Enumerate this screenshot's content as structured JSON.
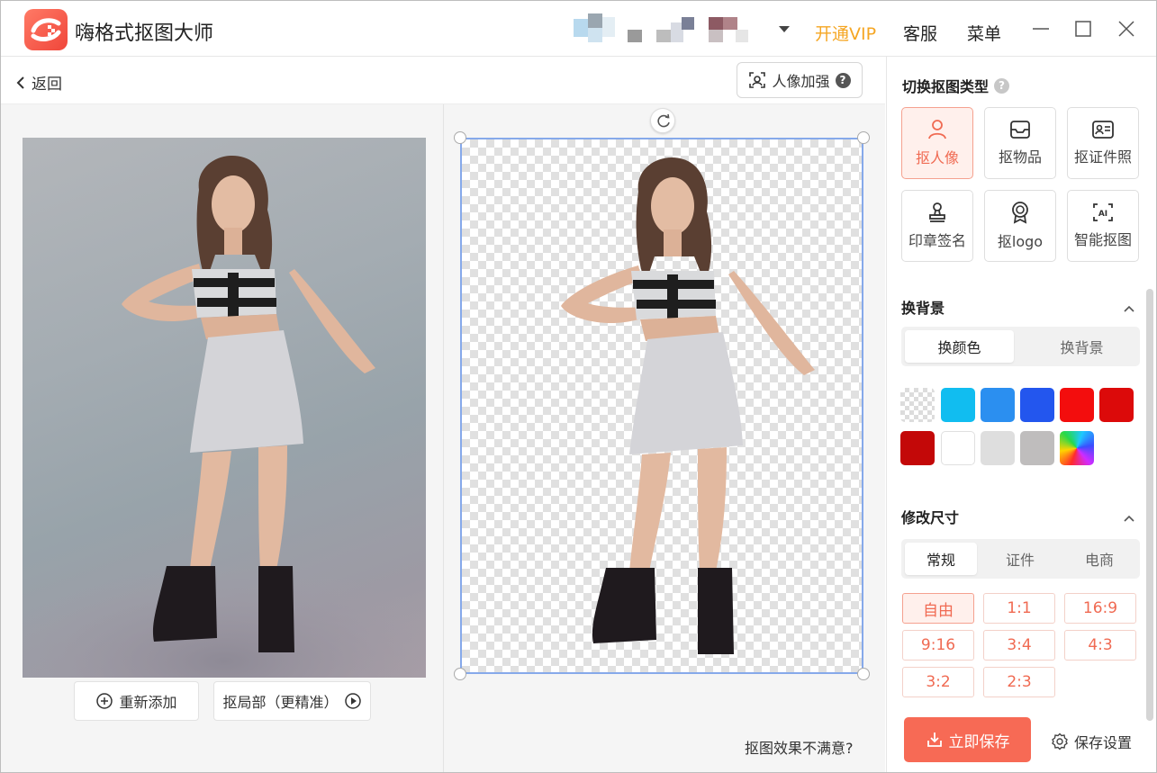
{
  "titlebar": {
    "app_title": "嗨格式抠图大师",
    "vip_label": "开通VIP",
    "service_label": "客服",
    "menu_label": "菜单"
  },
  "toolbar": {
    "back_label": "返回",
    "enhance_label": "人像加强"
  },
  "canvas": {
    "re_add_label": "重新添加",
    "partial_label": "抠局部（更精准）",
    "unsatisfied_label": "抠图效果不满意?"
  },
  "cutout_type": {
    "title": "切换抠图类型",
    "items": [
      {
        "label": "抠人像",
        "icon": "person-icon",
        "active": true
      },
      {
        "label": "抠物品",
        "icon": "inbox-icon",
        "active": false
      },
      {
        "label": "抠证件照",
        "icon": "id-card-icon",
        "active": false
      },
      {
        "label": "印章签名",
        "icon": "stamp-icon",
        "active": false
      },
      {
        "label": "抠logo",
        "icon": "badge-icon",
        "active": false
      },
      {
        "label": "智能抠图",
        "icon": "ai-icon",
        "active": false
      }
    ]
  },
  "background": {
    "title": "换背景",
    "tabs": [
      {
        "label": "换颜色",
        "active": true
      },
      {
        "label": "换背景",
        "active": false
      }
    ],
    "colors": [
      "transparent",
      "#11bdf0",
      "#2b8ff0",
      "#2356ee",
      "#f30d0d",
      "#dc0a0a",
      "#c30808",
      "#ffffff",
      "#dedede",
      "#bfbdbd",
      "gradient"
    ]
  },
  "resize": {
    "title": "修改尺寸",
    "tabs": [
      {
        "label": "常规",
        "active": true
      },
      {
        "label": "证件",
        "active": false
      },
      {
        "label": "电商",
        "active": false
      }
    ],
    "ratios": [
      {
        "label": "自由",
        "active": true
      },
      {
        "label": "1:1",
        "active": false
      },
      {
        "label": "16:9",
        "active": false
      },
      {
        "label": "9:16",
        "active": false
      },
      {
        "label": "3:4",
        "active": false
      },
      {
        "label": "4:3",
        "active": false
      },
      {
        "label": "3:2",
        "active": false
      },
      {
        "label": "2:3",
        "active": false
      }
    ]
  },
  "footer": {
    "save_label": "立即保存",
    "settings_label": "保存设置"
  },
  "colors": {
    "accent": "#f76a55",
    "vip": "#f5a623",
    "selection": "#86a9ea"
  }
}
